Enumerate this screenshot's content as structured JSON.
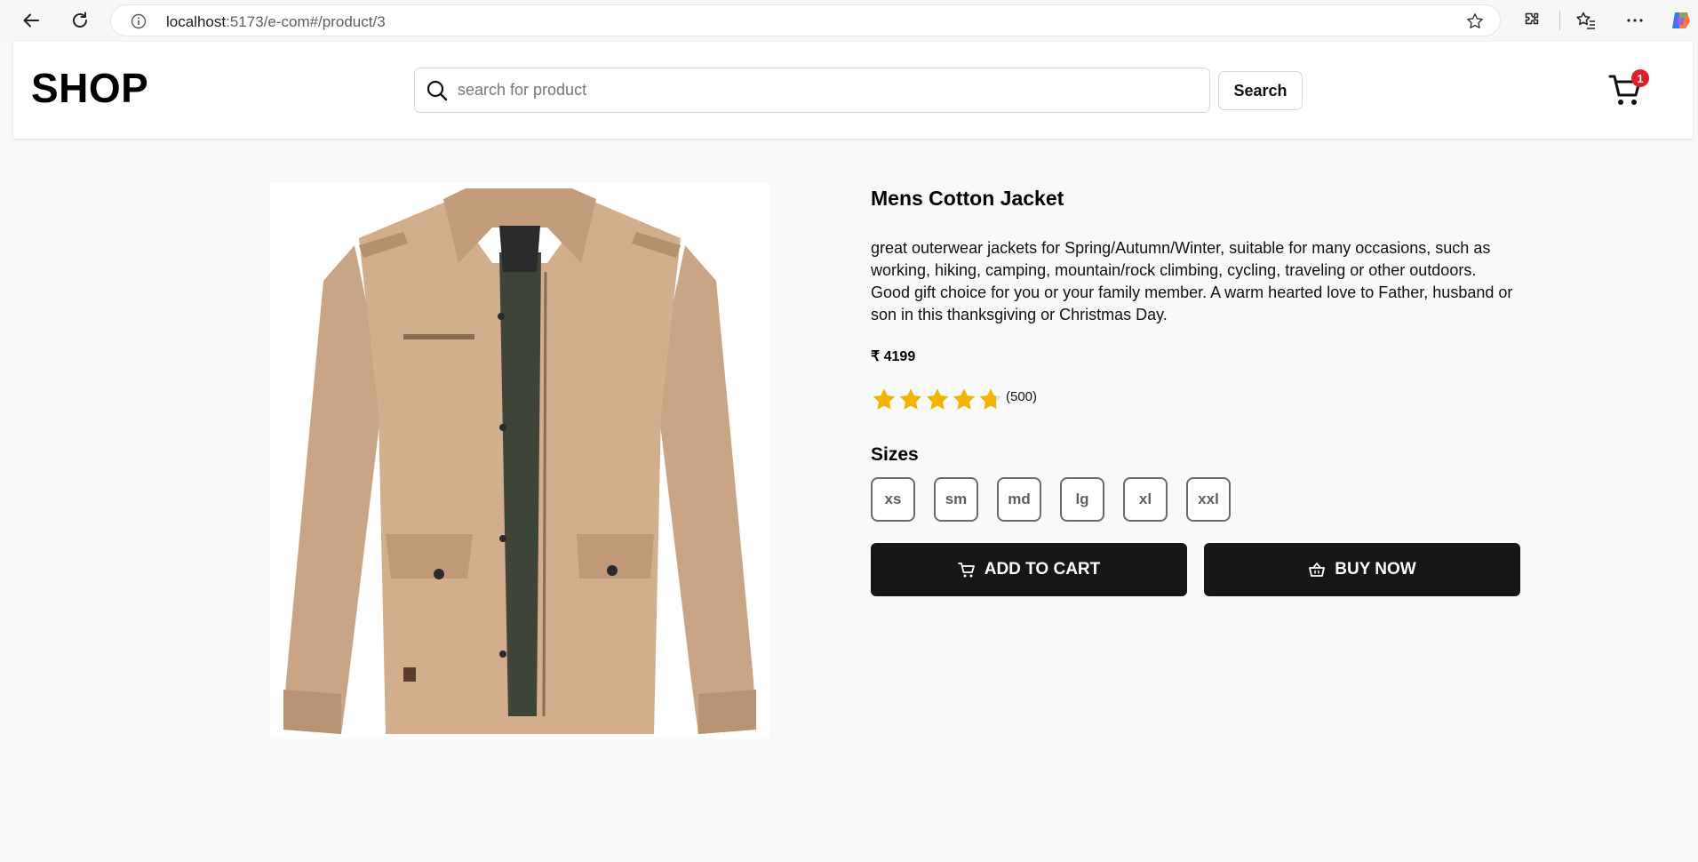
{
  "browser": {
    "url_host": "localhost",
    "url_path": ":5173/e-com#/product/3"
  },
  "header": {
    "logo": "SHOP",
    "search_placeholder": "search for product",
    "search_button": "Search",
    "cart_count": "1"
  },
  "product": {
    "title": "Mens Cotton Jacket",
    "description": "great outerwear jackets for Spring/Autumn/Winter, suitable for many occasions, such as working, hiking, camping, mountain/rock climbing, cycling, traveling or other outdoors. Good gift choice for you or your family member. A warm hearted love to Father, husband or son in this thanksgiving or Christmas Day.",
    "price": "₹ 4199",
    "rating_value": 4.7,
    "rating_max": 5,
    "rating_count": "(500)",
    "sizes_label": "Sizes",
    "sizes": [
      "xs",
      "sm",
      "md",
      "lg",
      "xl",
      "xxl"
    ],
    "add_to_cart": "ADD TO CART",
    "buy_now": "BUY NOW"
  },
  "colors": {
    "accent_dark": "#161616",
    "star": "#f5b301",
    "badge": "#e11d2e",
    "page_bg": "#f8f9fa"
  }
}
